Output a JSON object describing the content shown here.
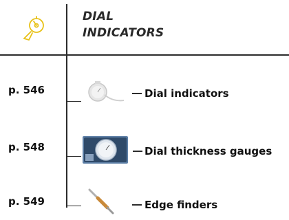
{
  "header": {
    "title_line1": "DIAL",
    "title_line2": "INDICATORS",
    "icon": "dial-gauge-icon",
    "accent_color": "#e8c21a"
  },
  "entries": [
    {
      "page": "p. 546",
      "label": "Dial indicators",
      "thumbnail": "dial-indicator-image"
    },
    {
      "page": "p. 548",
      "label": "Dial thickness gauges",
      "thumbnail": "dial-thickness-gauge-image"
    },
    {
      "page": "p. 549",
      "label": "Edge finders",
      "thumbnail": "edge-finder-image"
    }
  ]
}
